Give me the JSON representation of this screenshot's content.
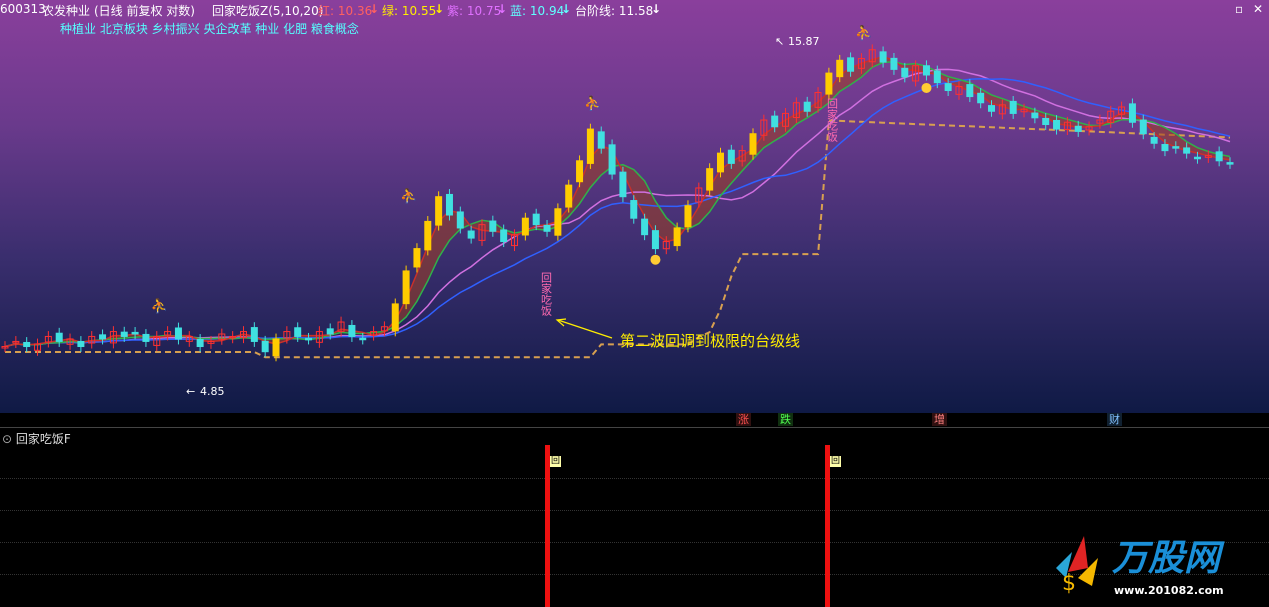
{
  "header": {
    "code": "600313",
    "stock_name": "农发种业",
    "period": "(日线 前复权 对数)",
    "indicator": "回家吃饭Z(5,10,20)",
    "red_label": "红: 10.36",
    "green_label": "绿: 10.55",
    "purple_label": "紫: 10.75",
    "blue_label": "蓝: 10.94",
    "step_label": "台阶线: 11.58",
    "down_arrow": "↓"
  },
  "concepts": "种植业 北京板块 乡村振兴 央企改革 种业 化肥 粮食概念",
  "annotation": "第二波回调到极限的台级线",
  "signal_text_1": "回家吃饭",
  "signal_text_2": "回家吃饭",
  "high_label": "15.87",
  "low_label": "4.85",
  "events": [
    "涨",
    "跌",
    "增",
    "财"
  ],
  "sub_panel": {
    "title": "回家吃饭F",
    "bar_label": "回"
  },
  "colors": {
    "red_line": "#c8302a",
    "green_line": "#2fb24a",
    "purple_line": "#d070e0",
    "blue_line": "#3060ff",
    "step_line": "#d8a050",
    "up_candle": "#ff3030",
    "down_candle": "#40e0e0",
    "strong_up": "#ffcc00",
    "annotation": "#ffee00"
  },
  "chart_data": {
    "type": "candlestick",
    "high": 15.87,
    "low": 4.85,
    "series": [
      {
        "name": "红",
        "last": 10.36
      },
      {
        "name": "绿",
        "last": 10.55
      },
      {
        "name": "紫",
        "last": 10.75
      },
      {
        "name": "蓝",
        "last": 10.94
      },
      {
        "name": "台阶线",
        "last": 11.58
      }
    ],
    "close_path": [
      5.3,
      5.4,
      5.3,
      5.35,
      5.5,
      5.4,
      5.45,
      5.3,
      5.5,
      5.45,
      5.6,
      5.5,
      5.55,
      5.4,
      5.5,
      5.6,
      5.45,
      5.5,
      5.3,
      5.4,
      5.55,
      5.5,
      5.6,
      5.4,
      5.2,
      5.45,
      5.6,
      5.5,
      5.45,
      5.6,
      5.55,
      5.8,
      5.5,
      5.45,
      5.6,
      5.7,
      6.2,
      7.0,
      7.6,
      8.4,
      9.2,
      8.6,
      8.2,
      7.9,
      8.3,
      8.1,
      7.8,
      8.0,
      8.5,
      8.3,
      8.1,
      8.8,
      9.6,
      10.5,
      11.8,
      11.0,
      10.0,
      9.2,
      8.5,
      8.0,
      7.6,
      7.8,
      8.2,
      8.9,
      9.5,
      10.2,
      10.8,
      10.4,
      10.9,
      11.6,
      12.2,
      11.9,
      12.5,
      13.0,
      12.6,
      13.5,
      14.5,
      15.2,
      14.6,
      15.3,
      15.8,
      15.1,
      14.7,
      14.3,
      14.9,
      14.4,
      14.0,
      13.6,
      13.8,
      13.3,
      13.0,
      12.6,
      12.9,
      12.5,
      12.7,
      12.3,
      12.0,
      11.8,
      12.1,
      11.7,
      11.9,
      12.2,
      12.6,
      12.8,
      12.1,
      11.6,
      11.2,
      10.9,
      11.0,
      10.8,
      10.6,
      10.7,
      10.5,
      10.4
    ]
  }
}
